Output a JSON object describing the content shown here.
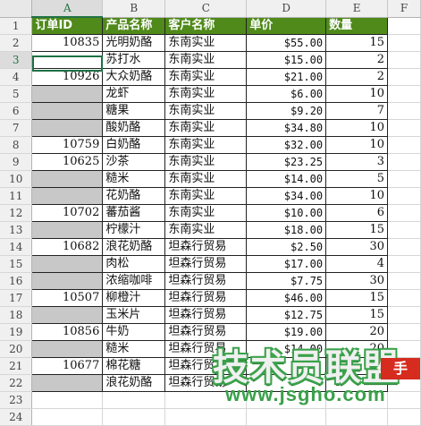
{
  "columns": [
    "A",
    "B",
    "C",
    "D",
    "E",
    "F"
  ],
  "active_column": "A",
  "header_row": [
    "订单ID",
    "产品名称",
    "客户名称",
    "单价",
    "数量"
  ],
  "rows": [
    {
      "n": "2",
      "id": "10835",
      "product": "光明奶酪",
      "customer": "东南实业",
      "price": "$55.00",
      "qty": "15",
      "grey": false
    },
    {
      "n": "3",
      "id": "",
      "product": "苏打水",
      "customer": "东南实业",
      "price": "$15.00",
      "qty": "2",
      "grey": false
    },
    {
      "n": "4",
      "id": "10926",
      "product": "大众奶酪",
      "customer": "东南实业",
      "price": "$21.00",
      "qty": "2",
      "grey": false
    },
    {
      "n": "5",
      "id": "",
      "product": "龙虾",
      "customer": "东南实业",
      "price": "$6.00",
      "qty": "10",
      "grey": true
    },
    {
      "n": "6",
      "id": "",
      "product": "糖果",
      "customer": "东南实业",
      "price": "$9.20",
      "qty": "7",
      "grey": true
    },
    {
      "n": "7",
      "id": "",
      "product": "酸奶酪",
      "customer": "东南实业",
      "price": "$34.80",
      "qty": "10",
      "grey": true
    },
    {
      "n": "8",
      "id": "10759",
      "product": "白奶酪",
      "customer": "东南实业",
      "price": "$32.00",
      "qty": "10",
      "grey": false
    },
    {
      "n": "9",
      "id": "10625",
      "product": "沙茶",
      "customer": "东南实业",
      "price": "$23.25",
      "qty": "3",
      "grey": false
    },
    {
      "n": "10",
      "id": "",
      "product": "糙米",
      "customer": "东南实业",
      "price": "$14.00",
      "qty": "5",
      "grey": true
    },
    {
      "n": "11",
      "id": "",
      "product": "花奶酪",
      "customer": "东南实业",
      "price": "$34.00",
      "qty": "10",
      "grey": true
    },
    {
      "n": "12",
      "id": "10702",
      "product": "蕃茄酱",
      "customer": "东南实业",
      "price": "$10.00",
      "qty": "6",
      "grey": false
    },
    {
      "n": "13",
      "id": "",
      "product": "柠檬汁",
      "customer": "东南实业",
      "price": "$18.00",
      "qty": "15",
      "grey": true
    },
    {
      "n": "14",
      "id": "10682",
      "product": "浪花奶酪",
      "customer": "坦森行贸易",
      "price": "$2.50",
      "qty": "30",
      "grey": false
    },
    {
      "n": "15",
      "id": "",
      "product": "肉松",
      "customer": "坦森行贸易",
      "price": "$17.00",
      "qty": "4",
      "grey": true
    },
    {
      "n": "16",
      "id": "",
      "product": "浓缩咖啡",
      "customer": "坦森行贸易",
      "price": "$7.75",
      "qty": "30",
      "grey": true
    },
    {
      "n": "17",
      "id": "10507",
      "product": "柳橙汁",
      "customer": "坦森行贸易",
      "price": "$46.00",
      "qty": "15",
      "grey": false
    },
    {
      "n": "18",
      "id": "",
      "product": "玉米片",
      "customer": "坦森行贸易",
      "price": "$12.75",
      "qty": "15",
      "grey": true
    },
    {
      "n": "19",
      "id": "10856",
      "product": "牛奶",
      "customer": "坦森行贸易",
      "price": "$19.00",
      "qty": "20",
      "grey": false
    },
    {
      "n": "20",
      "id": "",
      "product": "糙米",
      "customer": "坦森行贸易",
      "price": "$14.00",
      "qty": "20",
      "grey": true
    },
    {
      "n": "21",
      "id": "10677",
      "product": "棉花糖",
      "customer": "坦森行贸易",
      "price": "",
      "qty": "",
      "grey": false
    },
    {
      "n": "22",
      "id": "",
      "product": "浪花奶酪",
      "customer": "坦森行贸易",
      "price": "",
      "qty": "",
      "grey": true
    }
  ],
  "empty_rows": [
    "23",
    "24"
  ],
  "watermark": {
    "logo": "技术员联盟",
    "badge": "手",
    "url": "www.jsgho.com"
  },
  "colors": {
    "header_fill": "#4f8a1a",
    "grey_fill": "#c8c8c8",
    "selection": "#1e7145"
  }
}
